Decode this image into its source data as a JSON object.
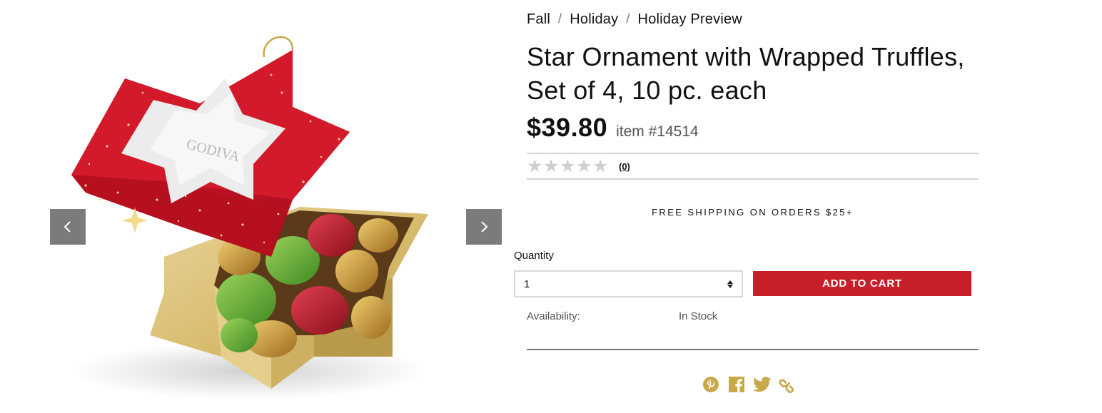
{
  "breadcrumb": {
    "items": [
      {
        "label": "Fall"
      },
      {
        "label": "Holiday"
      },
      {
        "label": "Holiday Preview"
      }
    ],
    "separator": "/"
  },
  "product": {
    "title": "Star Ornament with Wrapped Truffles, Set of 4, 10 pc. each",
    "price": "$39.80",
    "item_number": "item #14514",
    "rating": 0,
    "review_count": "(0)",
    "image_brand_text": "GODIVA"
  },
  "shipping": {
    "message": "FREE SHIPPING ON ORDERS $25+"
  },
  "purchase": {
    "quantity_label": "Quantity",
    "quantity_value": "1",
    "add_to_cart_label": "ADD TO CART"
  },
  "availability": {
    "label": "Availability:",
    "value": "In Stock"
  },
  "social": {
    "icons": [
      "pinterest-icon",
      "facebook-icon",
      "twitter-icon",
      "link-icon"
    ]
  },
  "colors": {
    "accent_red": "#c8202a",
    "social_gold": "#c9a84a",
    "arrow_gray": "#7b7b7b",
    "star_gray": "#cfcfcf"
  }
}
